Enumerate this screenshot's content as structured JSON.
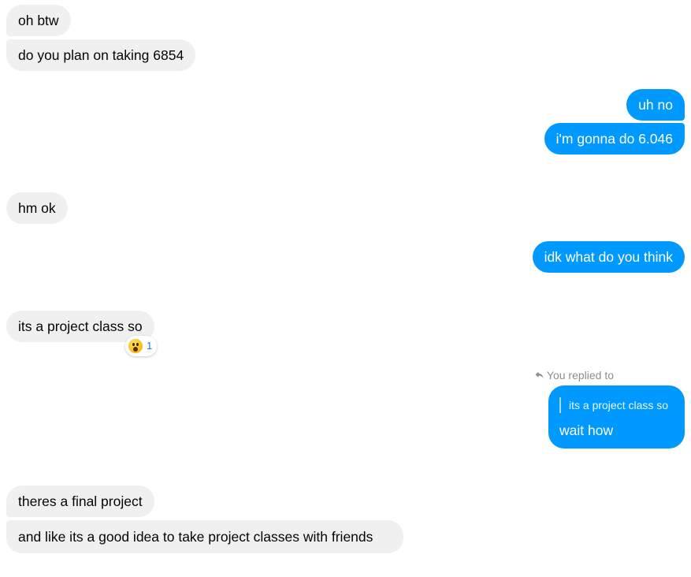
{
  "conversation": {
    "messages": [
      {
        "text": "oh btw",
        "sender": "them"
      },
      {
        "text": "do you plan on taking 6854",
        "sender": "them"
      },
      {
        "text": "uh no",
        "sender": "me"
      },
      {
        "text": "i'm gonna do 6.046",
        "sender": "me"
      },
      {
        "text": "hm ok",
        "sender": "them"
      },
      {
        "text": "idk what do you think",
        "sender": "me"
      },
      {
        "text": "its a project class so",
        "sender": "them"
      },
      {
        "text": "theres a final project",
        "sender": "them"
      },
      {
        "text": "and like its a good idea to take project classes with friends",
        "sender": "them"
      }
    ],
    "reaction": {
      "emoji": "surprised-face-emoji",
      "count": "1"
    },
    "reply": {
      "label": "You replied to",
      "quoted_text": "its a project class so",
      "text": "wait how"
    }
  },
  "colors": {
    "incoming_bubble": "#f0f0f0",
    "outgoing_bubble": "#0099ff",
    "reaction_count": "#0a7cff",
    "meta_text": "#8a8d91"
  }
}
